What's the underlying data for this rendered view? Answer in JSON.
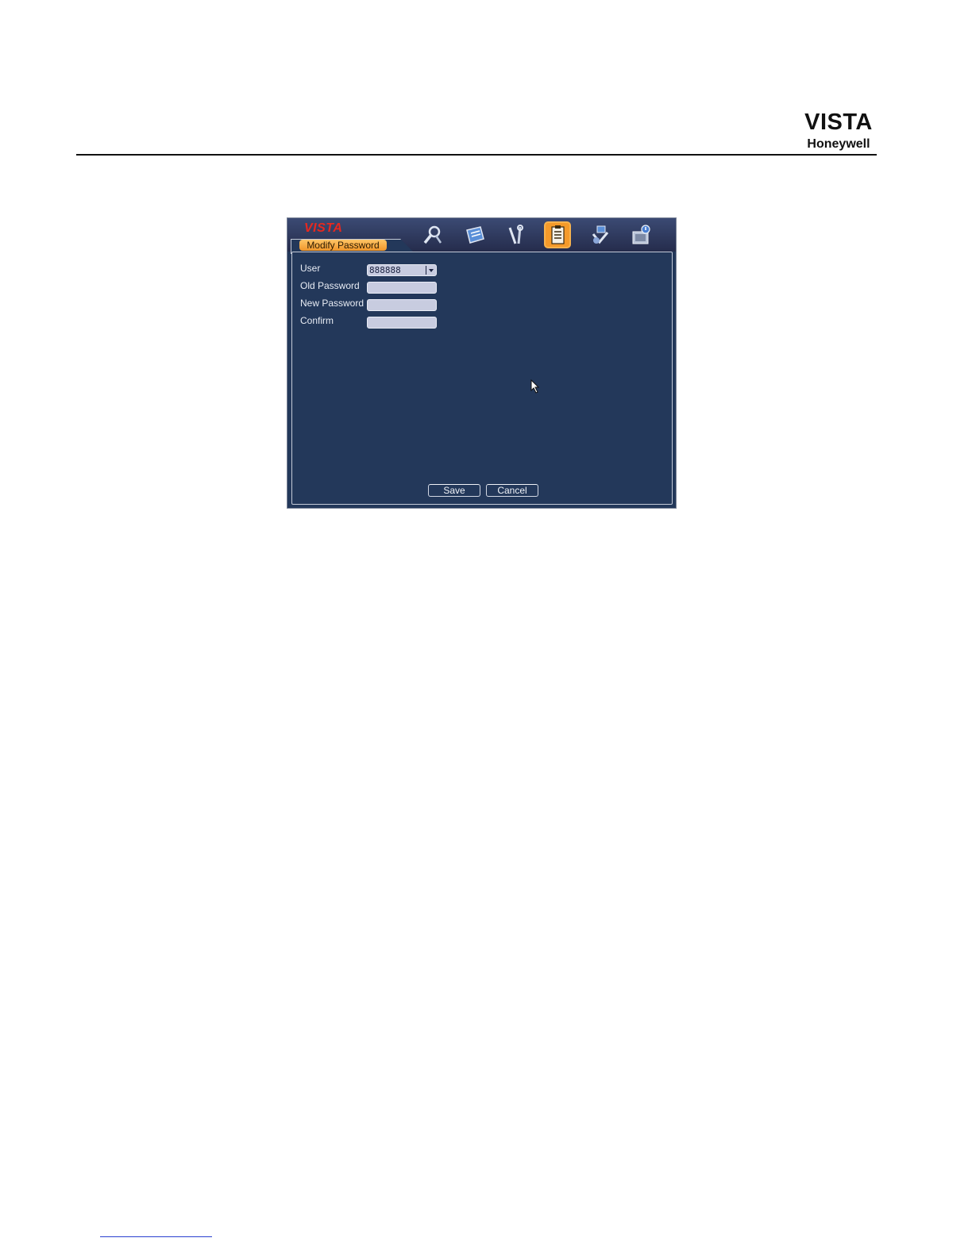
{
  "page": {
    "brand_primary": "VISTA",
    "brand_secondary": "Honeywell"
  },
  "dvr": {
    "logo": "VISTA",
    "active_tab": "Modify Password",
    "toolbar_icons": [
      {
        "name": "search-icon",
        "active": false
      },
      {
        "name": "information-icon",
        "active": false
      },
      {
        "name": "settings-icon",
        "active": false
      },
      {
        "name": "advanced-icon",
        "active": true
      },
      {
        "name": "backup-icon",
        "active": false
      },
      {
        "name": "shutdown-icon",
        "active": false
      }
    ],
    "form": {
      "user_label": "User",
      "user_value": "888888",
      "old_password_label": "Old Password",
      "old_password_value": "",
      "new_password_label": "New Password",
      "new_password_value": "",
      "confirm_label": "Confirm",
      "confirm_value": ""
    },
    "buttons": {
      "save": "Save",
      "cancel": "Cancel"
    }
  },
  "colors": {
    "panel_bg": "#23385a",
    "tab_accent": "#f59a2a",
    "logo_red": "#e8281e"
  }
}
